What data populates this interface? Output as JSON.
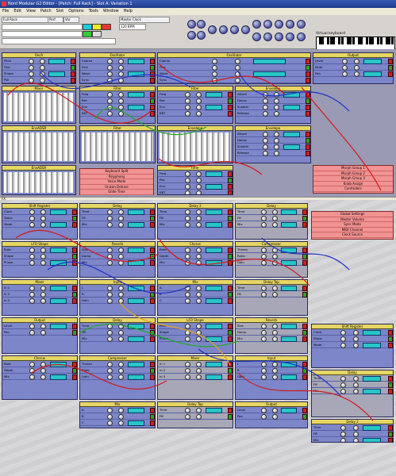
{
  "window": {
    "title": "Nord Modular G2 Editor - [Patch: Full Rack] - Slot A: Variation 1"
  },
  "menu": [
    "File",
    "Edit",
    "View",
    "Patch",
    "Slot",
    "Options",
    "Tools",
    "Window",
    "Help"
  ],
  "toolbar": {
    "keyboard_label": "Virtual keyboard",
    "slots": [
      "A",
      "B",
      "C",
      "D"
    ],
    "perf_label": "Perf",
    "patch_field": "Full Rack",
    "var_label": "Var",
    "mode_label": "Master Clock",
    "tempo": "120 BPM"
  },
  "colors": {
    "module": "#7c86c8",
    "header": "#e6d664",
    "display": "#27c6c6",
    "jack_red": "#c22",
    "pink": "#f29393",
    "cable_red": "#d41818",
    "cable_blue": "#2030c8"
  },
  "va_modules": [
    {
      "name": "OscA",
      "rows": [
        "Pitch",
        "Fine",
        "Shape",
        "PW"
      ]
    },
    {
      "name": "Oscillator",
      "rows": [
        "Coarse",
        "Fine",
        "Wave",
        "Sync"
      ]
    },
    {
      "name": "Oscillator",
      "rows": [
        "Coarse",
        "Fine",
        "Wave",
        "Sync"
      ]
    },
    {
      "name": "Output",
      "rows": [
        "Level",
        "Mute",
        "Pan"
      ]
    },
    {
      "name": "Mixer",
      "rows": [
        "In 1",
        "In 2",
        "In 3"
      ]
    },
    {
      "name": "Filter",
      "rows": [
        "Freq",
        "Res",
        "Env",
        "KBT"
      ]
    },
    {
      "name": "Filter",
      "rows": [
        "Freq",
        "Res",
        "Env",
        "KBT"
      ]
    },
    {
      "name": "Envelope",
      "rows": [
        "Attack",
        "Decay",
        "Sustain",
        "Release"
      ]
    },
    {
      "name": "EnvADSR",
      "rows": [
        "A",
        "D",
        "S",
        "R"
      ]
    },
    {
      "name": "EnvADSR",
      "rows": [
        "A",
        "D",
        "S",
        "R"
      ]
    }
  ],
  "pink_list_1": [
    "Keyboard Split",
    "Polyphony",
    "Voice Mode",
    "Unison Detune",
    "Glide Time"
  ],
  "pink_list_2": [
    "Morph Group 1",
    "Morph Group 2",
    "Morph Group 3",
    "Knob Assign",
    "Controllers"
  ],
  "fx_modules": [
    {
      "name": "Shift Register",
      "rows": [
        "Clock",
        "Steps",
        "Mode"
      ]
    },
    {
      "name": "Delay",
      "rows": [
        "Time",
        "FB",
        "Mix"
      ]
    },
    {
      "name": "Delay 2",
      "rows": [
        "Time",
        "FB",
        "Mix"
      ]
    },
    {
      "name": "Delay",
      "rows": [
        "Time",
        "FB",
        "Mix"
      ]
    },
    {
      "name": "LFO Shape",
      "rows": [
        "Rate",
        "Shape",
        "Phase"
      ]
    },
    {
      "name": "Reverb",
      "rows": [
        "Size",
        "Damp",
        "Mix"
      ]
    },
    {
      "name": "Chorus",
      "rows": [
        "Rate",
        "Depth",
        "Mix"
      ]
    },
    {
      "name": "Compressor",
      "rows": [
        "Thresh",
        "Ratio",
        "Gain"
      ]
    },
    {
      "name": "Mixer",
      "rows": [
        "In 1",
        "In 2",
        "In 3"
      ]
    },
    {
      "name": "Input",
      "rows": [
        "L",
        "R",
        "Gain"
      ]
    },
    {
      "name": "Mix",
      "rows": [
        "A",
        "B",
        "C"
      ]
    },
    {
      "name": "Delay Tap",
      "rows": [
        "Time",
        "FB"
      ]
    },
    {
      "name": "Output",
      "rows": [
        "Level",
        "Pan"
      ]
    }
  ],
  "fx_pink": [
    "Global Settings",
    "Master Volume",
    "Sync Mode",
    "MIDI Channel",
    "Clock Source"
  ]
}
